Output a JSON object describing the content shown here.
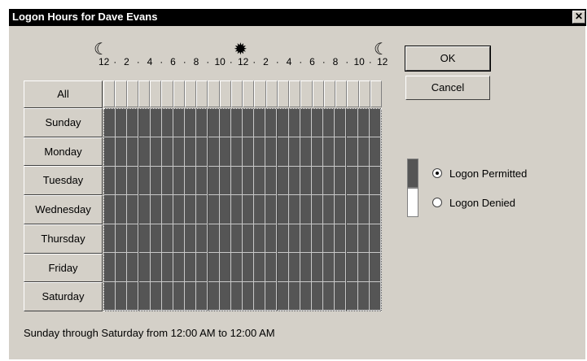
{
  "window": {
    "title": "Logon Hours for Dave Evans",
    "close_glyph": "✕"
  },
  "time_scale": {
    "hour_labels": [
      "12",
      "2",
      "4",
      "6",
      "8",
      "10",
      "12",
      "2",
      "4",
      "6",
      "8",
      "10",
      "12"
    ],
    "icons": [
      "moon-icon",
      "sun-icon",
      "moon-icon"
    ]
  },
  "grid": {
    "all_label": "All",
    "days": [
      "Sunday",
      "Monday",
      "Tuesday",
      "Wednesday",
      "Thursday",
      "Friday",
      "Saturday"
    ],
    "columns": 24,
    "permitted_hours_all_days": 24
  },
  "buttons": {
    "ok": "OK",
    "cancel": "Cancel"
  },
  "legend": {
    "permitted_label": "Logon Permitted",
    "denied_label": "Logon Denied",
    "selected": "permitted",
    "permitted_color": "#555555",
    "denied_color": "#ffffff"
  },
  "status_text": "Sunday through Saturday from 12:00 AM to 12:00 AM"
}
